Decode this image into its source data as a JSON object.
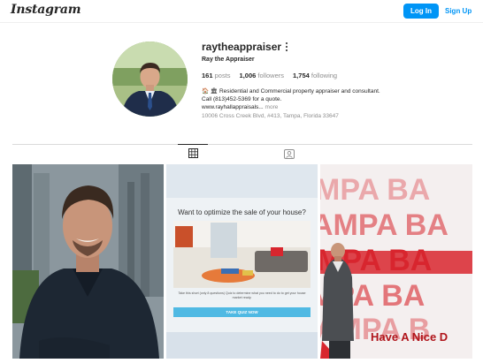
{
  "nav": {
    "logo": "Instagram",
    "login_label": "Log In",
    "signup_label": "Sign Up"
  },
  "profile": {
    "username": "raytheappraiser",
    "full_name": "Ray the Appraiser",
    "posts_count": "161",
    "posts_label": "posts",
    "followers_count": "1,006",
    "followers_label": "followers",
    "following_count": "1,754",
    "following_label": "following",
    "bio_line": "🏠 🏛 Residential and Commercial property appraiser and consultant. Call (813)452-5369 for a quote.",
    "link": "www.rayhallappraisals...",
    "more_label": "more",
    "address": "10006 Cross Creek Blvd, #413, Tampa, Florida 33647"
  },
  "tabs": [
    {
      "name": "posts",
      "icon": "grid-icon",
      "active": true
    },
    {
      "name": "tagged",
      "icon": "tagged-icon",
      "active": false
    }
  ],
  "posts": {
    "quiz_title": "Want to optimize the sale of your house?",
    "quiz_text": "Take this short (only 8 questions) Quiz to determine what you need to do to get your house market ready.",
    "quiz_button": "TAKE QUIZ NOW",
    "banner_text": "Have A Nice D",
    "banner_letters": "MPA BA"
  },
  "colors": {
    "accent": "#0095f6",
    "banner_red": "#d8262e",
    "quiz_button": "#4fb9e3"
  }
}
